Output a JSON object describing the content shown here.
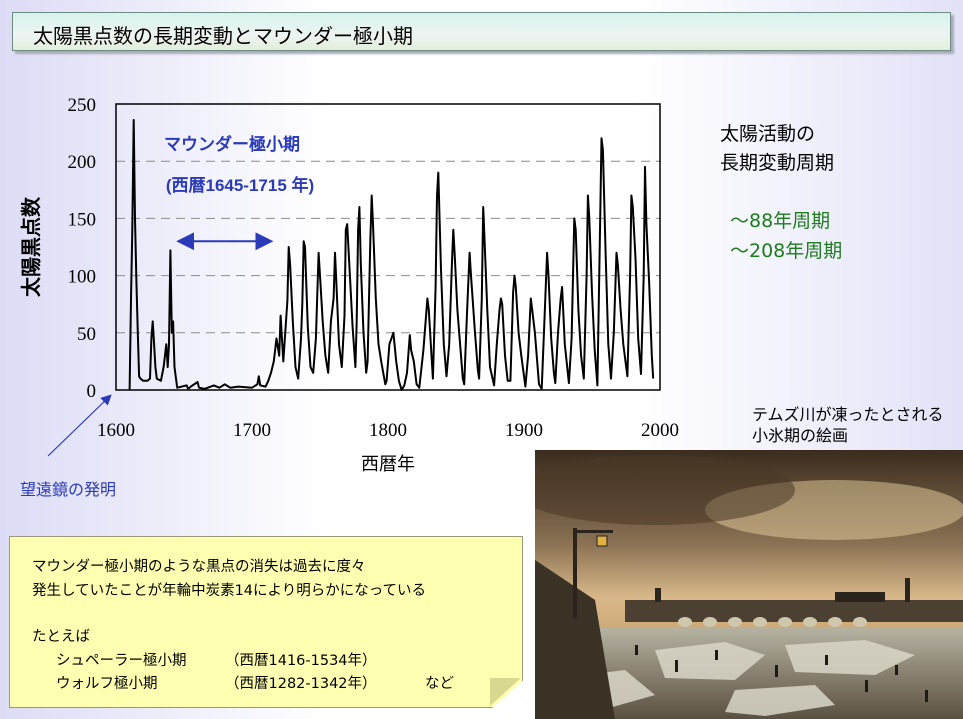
{
  "slide": {
    "title": "太陽黒点数の長期変動とマウンダー極小期",
    "cycles_title_line1": "太陽活動の",
    "cycles_title_line2": "長期変動周期",
    "cycle_1": "～88年周期",
    "cycle_2": "～208年周期",
    "telescope_label": "望遠鏡の発明",
    "painting_caption_line1": "テムズ川が凍ったとされる",
    "painting_caption_line2": "小氷期の絵画",
    "note_line1": "マウンダー極小期のような黒点の消失は過去に度々",
    "note_line2": "発生していたことが年輪中炭素14により明らかになっている",
    "note_line3": "たとえば",
    "note_line4a": "シュペーラー極小期",
    "note_line4b": "（西暦1416-1534年）",
    "note_line5a": "ウォルフ極小期",
    "note_line5b": "（西暦1282-1342年）",
    "note_line5c": "など"
  },
  "colors": {
    "accent_blue": "#2b3ab8",
    "cycle_green": "#1e7b1e",
    "note_background": "#ffffb2"
  },
  "chart_data": {
    "type": "line",
    "xlabel": "西暦年",
    "ylabel": "太陽黒点数",
    "xlim": [
      1600,
      2000
    ],
    "ylim": [
      0,
      250
    ],
    "x_ticks": [
      1600,
      1700,
      1800,
      1900,
      2000
    ],
    "y_ticks": [
      0,
      50,
      100,
      150,
      200,
      250
    ],
    "grid": "horizontal dashed",
    "annotation_title": "マウンダー極小期",
    "annotation_range": "(西暦1645-1715 年)",
    "maunder_minimum": [
      1645,
      1715
    ],
    "series": [
      {
        "values": [
          [
            1610,
            0
          ],
          [
            1611,
            80
          ],
          [
            1612,
            140
          ],
          [
            1613,
            236
          ],
          [
            1614,
            150
          ],
          [
            1615,
            95
          ],
          [
            1616,
            50
          ],
          [
            1617,
            12
          ],
          [
            1618,
            10
          ],
          [
            1620,
            8
          ],
          [
            1623,
            8
          ],
          [
            1625,
            10
          ],
          [
            1626,
            45
          ],
          [
            1627,
            60
          ],
          [
            1628,
            40
          ],
          [
            1629,
            20
          ],
          [
            1630,
            10
          ],
          [
            1633,
            8
          ],
          [
            1635,
            20
          ],
          [
            1637,
            40
          ],
          [
            1638,
            20
          ],
          [
            1639,
            40
          ],
          [
            1640,
            122
          ],
          [
            1641,
            50
          ],
          [
            1642,
            60
          ],
          [
            1643,
            20
          ],
          [
            1645,
            2
          ],
          [
            1652,
            4
          ],
          [
            1653,
            1
          ],
          [
            1655,
            3
          ],
          [
            1660,
            7
          ],
          [
            1661,
            2
          ],
          [
            1665,
            1
          ],
          [
            1672,
            4
          ],
          [
            1676,
            2
          ],
          [
            1680,
            5
          ],
          [
            1684,
            2
          ],
          [
            1690,
            3
          ],
          [
            1700,
            2
          ],
          [
            1704,
            5
          ],
          [
            1705,
            12
          ],
          [
            1706,
            4
          ],
          [
            1710,
            3
          ],
          [
            1712,
            8
          ],
          [
            1714,
            15
          ],
          [
            1716,
            25
          ],
          [
            1718,
            45
          ],
          [
            1720,
            30
          ],
          [
            1721,
            65
          ],
          [
            1723,
            25
          ],
          [
            1725,
            60
          ],
          [
            1726,
            78
          ],
          [
            1727,
            125
          ],
          [
            1728,
            110
          ],
          [
            1730,
            60
          ],
          [
            1732,
            20
          ],
          [
            1734,
            10
          ],
          [
            1736,
            45
          ],
          [
            1737,
            75
          ],
          [
            1738,
            130
          ],
          [
            1739,
            125
          ],
          [
            1741,
            55
          ],
          [
            1743,
            20
          ],
          [
            1745,
            15
          ],
          [
            1747,
            45
          ],
          [
            1749,
            120
          ],
          [
            1750,
            100
          ],
          [
            1752,
            60
          ],
          [
            1754,
            30
          ],
          [
            1756,
            15
          ],
          [
            1758,
            60
          ],
          [
            1760,
            80
          ],
          [
            1761,
            120
          ],
          [
            1762,
            95
          ],
          [
            1764,
            40
          ],
          [
            1766,
            20
          ],
          [
            1768,
            65
          ],
          [
            1769,
            140
          ],
          [
            1770,
            145
          ],
          [
            1772,
            100
          ],
          [
            1774,
            55
          ],
          [
            1776,
            20
          ],
          [
            1777,
            60
          ],
          [
            1778,
            140
          ],
          [
            1779,
            160
          ],
          [
            1780,
            110
          ],
          [
            1782,
            50
          ],
          [
            1784,
            15
          ],
          [
            1785,
            25
          ],
          [
            1787,
            130
          ],
          [
            1788,
            170
          ],
          [
            1789,
            145
          ],
          [
            1791,
            80
          ],
          [
            1793,
            40
          ],
          [
            1795,
            25
          ],
          [
            1798,
            5
          ],
          [
            1799,
            8
          ],
          [
            1801,
            40
          ],
          [
            1804,
            50
          ],
          [
            1806,
            25
          ],
          [
            1808,
            8
          ],
          [
            1810,
            0
          ],
          [
            1812,
            4
          ],
          [
            1814,
            15
          ],
          [
            1816,
            48
          ],
          [
            1817,
            35
          ],
          [
            1819,
            25
          ],
          [
            1821,
            5
          ],
          [
            1823,
            2
          ],
          [
            1826,
            35
          ],
          [
            1829,
            80
          ],
          [
            1830,
            70
          ],
          [
            1832,
            30
          ],
          [
            1833,
            10
          ],
          [
            1835,
            90
          ],
          [
            1836,
            170
          ],
          [
            1837,
            190
          ],
          [
            1839,
            105
          ],
          [
            1841,
            40
          ],
          [
            1843,
            12
          ],
          [
            1845,
            40
          ],
          [
            1847,
            110
          ],
          [
            1848,
            140
          ],
          [
            1849,
            120
          ],
          [
            1851,
            70
          ],
          [
            1853,
            40
          ],
          [
            1855,
            10
          ],
          [
            1856,
            5
          ],
          [
            1858,
            65
          ],
          [
            1860,
            120
          ],
          [
            1861,
            100
          ],
          [
            1864,
            50
          ],
          [
            1866,
            18
          ],
          [
            1867,
            10
          ],
          [
            1869,
            80
          ],
          [
            1870,
            160
          ],
          [
            1871,
            130
          ],
          [
            1873,
            70
          ],
          [
            1875,
            20
          ],
          [
            1878,
            4
          ],
          [
            1880,
            40
          ],
          [
            1882,
            70
          ],
          [
            1883,
            80
          ],
          [
            1884,
            75
          ],
          [
            1886,
            30
          ],
          [
            1888,
            8
          ],
          [
            1890,
            8
          ],
          [
            1892,
            85
          ],
          [
            1893,
            100
          ],
          [
            1894,
            90
          ],
          [
            1896,
            50
          ],
          [
            1898,
            30
          ],
          [
            1901,
            3
          ],
          [
            1903,
            30
          ],
          [
            1905,
            80
          ],
          [
            1906,
            70
          ],
          [
            1908,
            50
          ],
          [
            1911,
            5
          ],
          [
            1913,
            1
          ],
          [
            1915,
            60
          ],
          [
            1917,
            120
          ],
          [
            1918,
            100
          ],
          [
            1920,
            45
          ],
          [
            1922,
            15
          ],
          [
            1923,
            6
          ],
          [
            1925,
            50
          ],
          [
            1927,
            80
          ],
          [
            1928,
            90
          ],
          [
            1930,
            40
          ],
          [
            1933,
            6
          ],
          [
            1935,
            45
          ],
          [
            1937,
            150
          ],
          [
            1938,
            140
          ],
          [
            1940,
            70
          ],
          [
            1942,
            30
          ],
          [
            1944,
            10
          ],
          [
            1946,
            100
          ],
          [
            1947,
            170
          ],
          [
            1948,
            150
          ],
          [
            1950,
            85
          ],
          [
            1952,
            35
          ],
          [
            1954,
            4
          ],
          [
            1956,
            150
          ],
          [
            1957,
            220
          ],
          [
            1958,
            210
          ],
          [
            1960,
            120
          ],
          [
            1962,
            40
          ],
          [
            1964,
            10
          ],
          [
            1966,
            50
          ],
          [
            1968,
            120
          ],
          [
            1969,
            110
          ],
          [
            1971,
            70
          ],
          [
            1973,
            40
          ],
          [
            1976,
            12
          ],
          [
            1978,
            100
          ],
          [
            1979,
            170
          ],
          [
            1980,
            160
          ],
          [
            1982,
            115
          ],
          [
            1984,
            45
          ],
          [
            1986,
            14
          ],
          [
            1988,
            100
          ],
          [
            1989,
            195
          ],
          [
            1990,
            145
          ],
          [
            1992,
            95
          ],
          [
            1994,
            30
          ],
          [
            1995,
            10
          ]
        ]
      }
    ]
  }
}
